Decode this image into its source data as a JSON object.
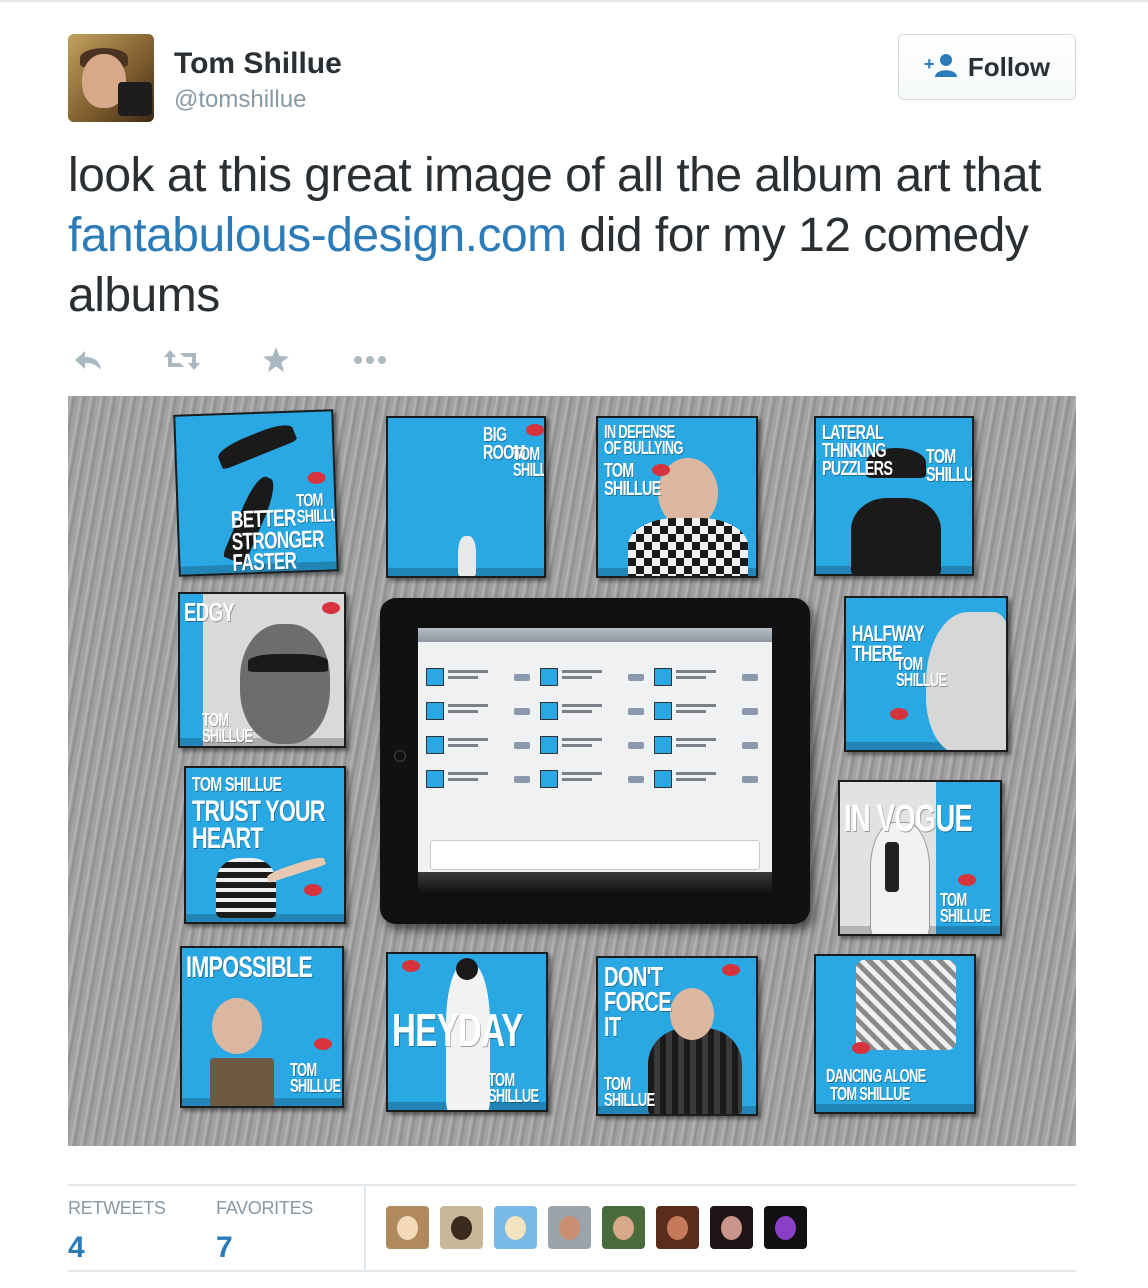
{
  "tweet": {
    "author_name": "Tom Shillue",
    "author_handle": "@tomshillue",
    "follow_label": "Follow",
    "text_before": "look at this great image of all the album art that ",
    "link_text": "fantabulous-design.com",
    "text_after": " did for my 12 comedy albums"
  },
  "actions": [
    {
      "name": "reply-icon"
    },
    {
      "name": "retweet-icon"
    },
    {
      "name": "favorite-icon"
    },
    {
      "name": "more-icon"
    }
  ],
  "media": {
    "albums": [
      {
        "title": "BETTER\nSTRONGER\nFASTER",
        "artist": "TOM\nSHILLUE"
      },
      {
        "title": "BIG\nROOM",
        "artist": "TOM\nSHILLUE"
      },
      {
        "title": "IN DEFENSE\nOF BULLYING",
        "artist": "TOM\nSHILLUE"
      },
      {
        "title": "LATERAL\nTHINKING\nPUZZLERS",
        "artist": "TOM\nSHILLUE"
      },
      {
        "title": "EDGY",
        "artist": "TOM\nSHILLUE"
      },
      {
        "title": "HALFWAY\nTHERE",
        "artist": "TOM\nSHILLUE"
      },
      {
        "title": "TRUST YOUR\nHEART",
        "artist": "TOM SHILLUE"
      },
      {
        "title": "IN VOGUE",
        "artist": "TOM\nSHILLUE"
      },
      {
        "title": "IMPOSSIBLE",
        "artist": "TOM\nSHILLUE"
      },
      {
        "title": "HEYDAY",
        "artist": "TOM\nSHILLUE"
      },
      {
        "title": "DON'T\nFORCE\nIT",
        "artist": "TOM\nSHILLUE"
      },
      {
        "title": "DANCING ALONE",
        "artist": "TOM SHILLUE"
      }
    ]
  },
  "stats": {
    "retweets_label": "RETWEETS",
    "retweets_count": "4",
    "favorites_label": "FAVORITES",
    "favorites_count": "7"
  },
  "favoriters": [
    {
      "name": "favoriter-avatar-1",
      "bg": "#b08a5c",
      "fg": "#f2d9b8"
    },
    {
      "name": "favoriter-avatar-2",
      "bg": "#c9b79a",
      "fg": "#3b2a1e"
    },
    {
      "name": "favoriter-avatar-3",
      "bg": "#79b9e6",
      "fg": "#f4e3c1"
    },
    {
      "name": "favoriter-avatar-4",
      "bg": "#9aa3aa",
      "fg": "#c98e73"
    },
    {
      "name": "favoriter-avatar-5",
      "bg": "#4a6b3a",
      "fg": "#d9a88b"
    },
    {
      "name": "favoriter-avatar-6",
      "bg": "#5a2c1c",
      "fg": "#c77a5a"
    },
    {
      "name": "favoriter-avatar-7",
      "bg": "#1e1416",
      "fg": "#c9958a"
    },
    {
      "name": "favoriter-avatar-8",
      "bg": "#111111",
      "fg": "#8b3fc9"
    }
  ],
  "colors": {
    "link": "#2b7bb9",
    "muted": "#8899a6",
    "text": "#292f33",
    "album_blue": "#2aa8e4"
  }
}
